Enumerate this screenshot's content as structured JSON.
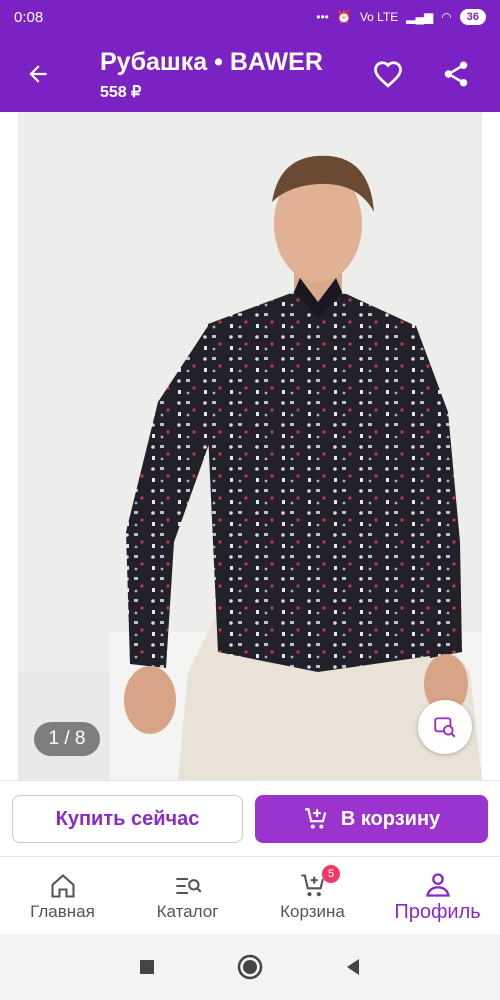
{
  "status": {
    "time": "0:08",
    "network": "Vo LTE",
    "battery": "36"
  },
  "header": {
    "title": "Рубашка • BAWER",
    "price": "558 ₽"
  },
  "gallery": {
    "counter": "1 / 8"
  },
  "actions": {
    "buy_now": "Купить сейчас",
    "add_to_cart": "В корзину"
  },
  "nav": {
    "items": [
      {
        "label": "Главная",
        "icon": "home-icon"
      },
      {
        "label": "Каталог",
        "icon": "catalog-search-icon"
      },
      {
        "label": "Корзина",
        "icon": "cart-icon",
        "badge": "5"
      },
      {
        "label": "Профиль",
        "icon": "profile-icon"
      }
    ],
    "active": "Профиль"
  },
  "colors": {
    "brand": "#7b22c4",
    "accent": "#9b34cf",
    "badge": "#ee3a66"
  }
}
